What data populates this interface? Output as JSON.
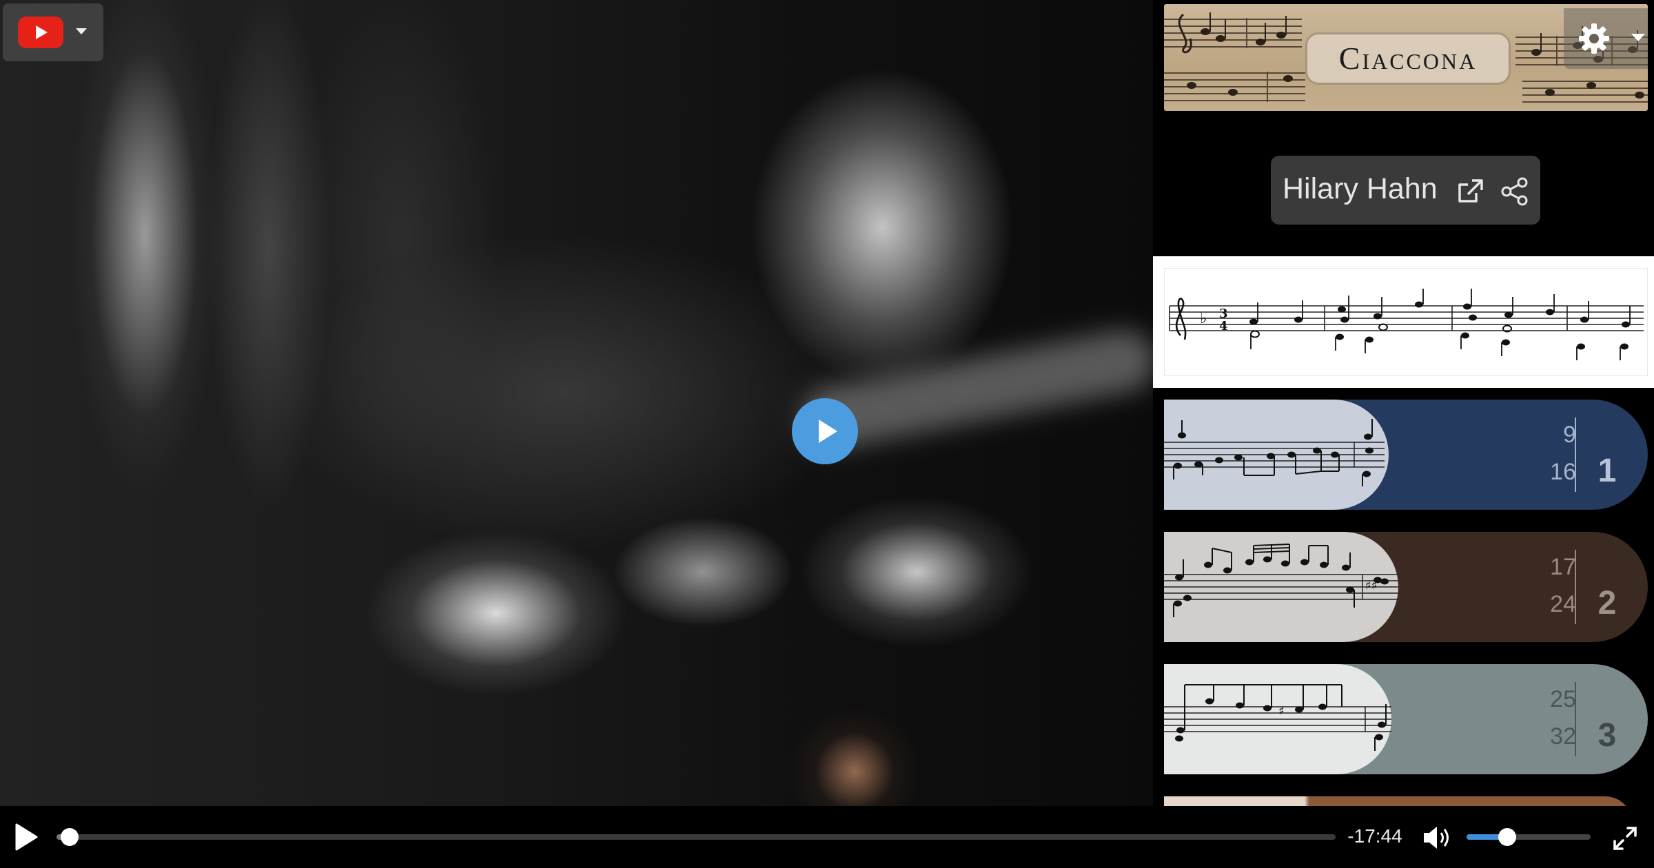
{
  "player": {
    "remaining_time": "-17:44",
    "progress": 0.01,
    "volume": 0.33
  },
  "banner": {
    "title": "Ciaccona"
  },
  "performer": {
    "name": "Hilary Hahn"
  },
  "variations": [
    {
      "number": "1",
      "start": "9",
      "end": "16",
      "color": "#243a5e",
      "thumb_color": "#c9cfdb",
      "text_color": "#a6b3c9",
      "num_color": "#b7c3d8"
    },
    {
      "number": "2",
      "start": "17",
      "end": "24",
      "color": "#3b2a21",
      "thumb_color": "#d2cecc",
      "text_color": "#9a8a80",
      "num_color": "#a09288"
    },
    {
      "number": "3",
      "start": "25",
      "end": "32",
      "color": "#7d8a8b",
      "thumb_color": "#e6e7e7",
      "text_color": "#4b5556",
      "num_color": "#3e4849"
    }
  ],
  "icons": {
    "youtube": "youtube-logo",
    "settings": "gear-icon",
    "external_link": "external-link-icon",
    "share": "share-icon",
    "play": "play-icon",
    "volume": "volume-icon",
    "fullscreen": "fullscreen-icon"
  }
}
